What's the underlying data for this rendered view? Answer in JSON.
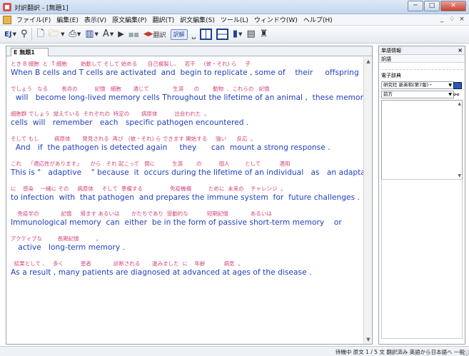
{
  "window": {
    "title": "対訳翻訳 - [無題1]",
    "minimize": "─",
    "maximize": "□",
    "close": "✕"
  },
  "menu": {
    "items": [
      "ファイル(F)",
      "編集(E)",
      "表示(V)",
      "原文編集(P)",
      "翻訳(T)",
      "訳文編集(S)",
      "ツール(L)",
      "ウィンドウ(W)",
      "ヘルプ(H)"
    ],
    "doc_min": "_",
    "doc_restore": "♢",
    "doc_close": "×"
  },
  "toolbar": {
    "ej_label": "EJ",
    "translate_label": "翻訳",
    "translate_all_label": "訳解"
  },
  "document": {
    "tab_label": "E 無題1",
    "segments": [
      {
        "jp": "とき B 細胞  と  T 細胞        始動して そして 始める      自己複製し、   若干     (彼・それ) ら     子",
        "en": "When B cells and T cells are activated  and  begin to replicate , some of    their     offspring"
      },
      {
        "jp": "でしょう   なる        長命の          記憶   細胞       通じて              生涯      の        動物  、これらの   記憶",
        "en": "  will   become long-lived memory cells Throughout the lifetime of an animal ,  these memory"
      },
      {
        "jp": "細胞群 でしょう  覚えている  それぞれの  特定の       病原体          出会われた  。",
        "en": "cells  will   remember   each   specific pathogen encountered ."
      },
      {
        "jp": "そして もし         病原体       発見される  再び   (彼・それ) ら できます 開始する     強い      反応  。",
        "en": "  And   if  the pathogen is detected again     they      can  mount a strong response ."
      },
      {
        "jp": "これ    「適応性があります」     から   それ 起こって   間に          生涯        の          個人         として           適用",
        "en": "This is \"   adaptive    \" because  it  occurs during the lifetime of an individual   as   an adaptation"
      },
      {
        "jp": "に    感染    一緒に その     病原体     そして  準備する                免疫機構          ために  未来の    チャレンジ  。",
        "en": "to infection  with  that pathogen  and prepares the immune system  for  future challenges ."
      },
      {
        "jp": "    免疫学の             記憶     帰ます あるいは       かたちであり  受動的な           短期記憶             あるいは",
        "en": "Immunological memory  can  either  be in the form of passive short-term memory    or"
      },
      {
        "jp": "アクティブな         長期記憶          。",
        "en": "   active   long-term memory ."
      },
      {
        "jp": "  結果として 、   多く          患者             診断される       進みました  に    年齢           病気  。",
        "en": "As a result , many patients are diagnosed at advanced at ages of the disease ."
      }
    ]
  },
  "side_panel": {
    "title": "単語情報",
    "close": "×",
    "tab": "訳語",
    "heading": "電子辞典",
    "dict_select": "研究社 新英和(第7版)・",
    "direction_select": "前方"
  },
  "status": {
    "text": "待機中  原文  1 / 5 文  翻訳済み  英語から日本語へ  一般"
  }
}
